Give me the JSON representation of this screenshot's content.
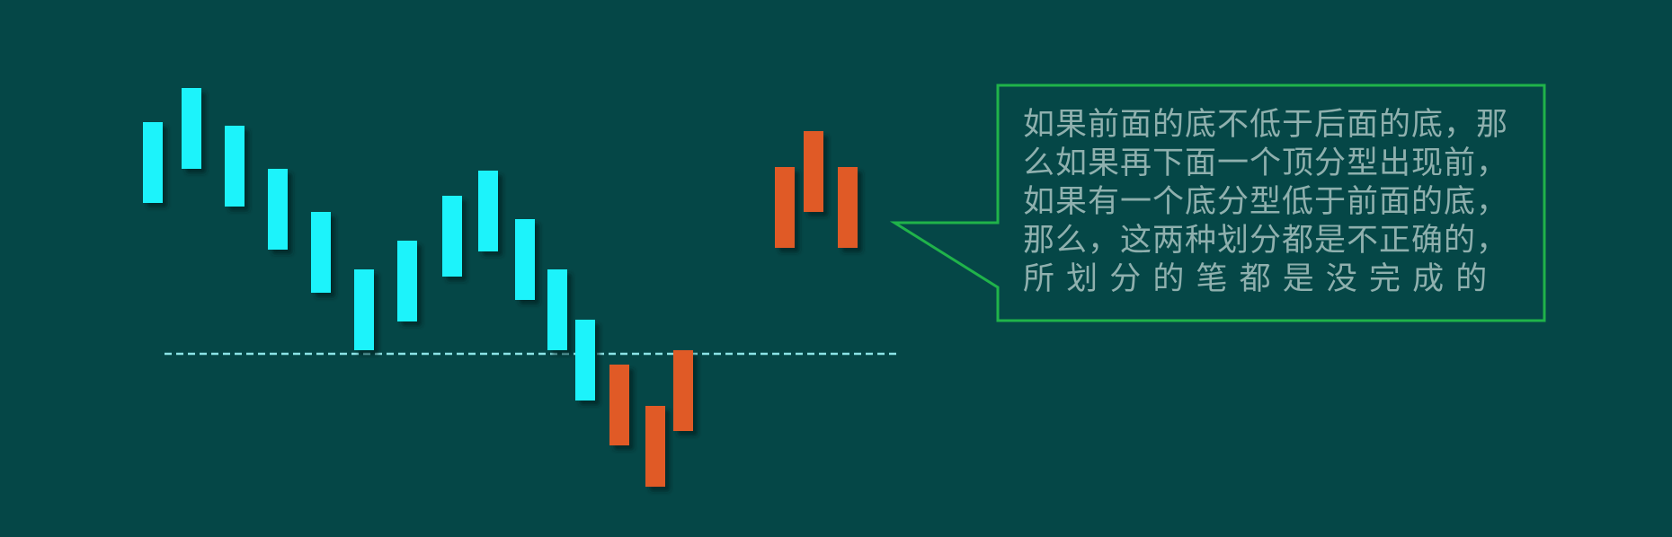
{
  "colors": {
    "background": "#054747",
    "rising_bar": "#1ff3fb",
    "falling_bar": "#e05a26",
    "reference_line": "#8be3e6",
    "callout_border": "#20b34a",
    "callout_text": "#8fb0ae"
  },
  "reference_line_style": "dashed",
  "callout": {
    "lines": [
      "如果前面的底不低于后面的底，那",
      "么如果再下面一个顶分型出现前，",
      "如果有一个底分型低于前面的底，",
      "那么，这两种划分都是不正确的，",
      "所 划 分 的 笔 都 是 没 完 成 的"
    ]
  }
}
